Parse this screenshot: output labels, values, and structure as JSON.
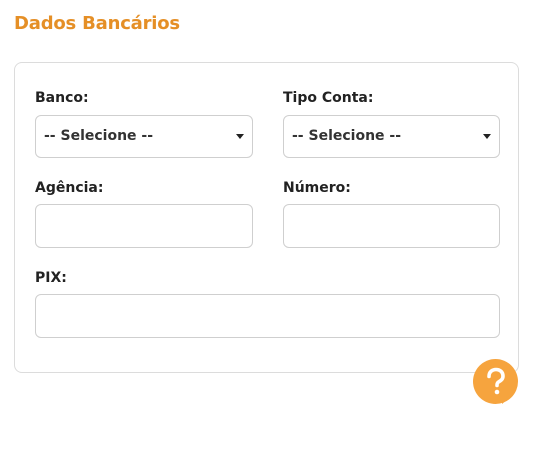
{
  "section": {
    "title": "Dados Bancários"
  },
  "form": {
    "banco": {
      "label": "Banco:",
      "selected": "-- Selecione --"
    },
    "tipo_conta": {
      "label": "Tipo Conta:",
      "selected": "-- Selecione --"
    },
    "agencia": {
      "label": "Agência:",
      "value": ""
    },
    "numero": {
      "label": "Número:",
      "value": ""
    },
    "pix": {
      "label": "PIX:",
      "value": ""
    }
  },
  "help": {
    "icon": "question-icon",
    "color": "#f6a43e"
  },
  "colors": {
    "title": "#e58f26",
    "border": "#dcdcdc",
    "input_border": "#cfcfcf"
  }
}
